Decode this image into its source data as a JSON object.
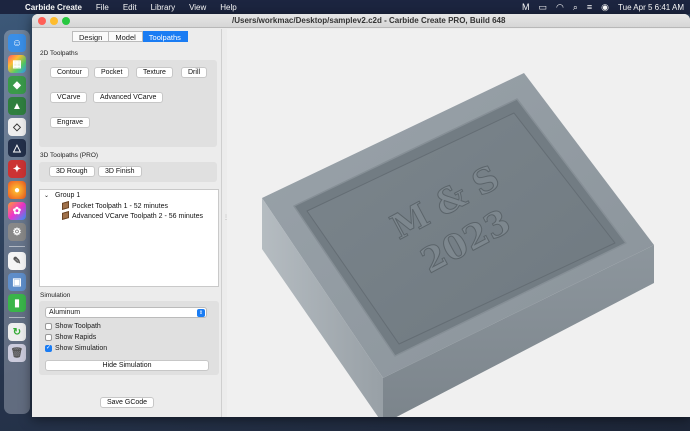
{
  "menubar": {
    "app_name": "Carbide Create",
    "items": [
      "File",
      "Edit",
      "Library",
      "View",
      "Help"
    ],
    "datetime": "Tue Apr 5  6:41 AM"
  },
  "window": {
    "title": "/Users/workmac/Desktop/samplev2.c2d - Carbide Create PRO, Build 648"
  },
  "tabs": [
    {
      "label": "Design",
      "active": false
    },
    {
      "label": "Model",
      "active": false
    },
    {
      "label": "Toolpaths",
      "active": true
    }
  ],
  "toolpaths_2d": {
    "heading": "2D Toolpaths",
    "buttons": [
      "Contour",
      "Pocket",
      "Texture",
      "Drill",
      "VCarve",
      "Advanced VCarve",
      "Engrave"
    ]
  },
  "toolpaths_3d": {
    "heading": "3D Toolpaths (PRO)",
    "buttons": [
      "3D Rough",
      "3D Finish"
    ]
  },
  "tree": {
    "group_label": "Group 1",
    "items": [
      "Pocket Toolpath 1 - 52 minutes",
      "Advanced VCarve Toolpath 2 - 56 minutes"
    ]
  },
  "simulation": {
    "heading": "Simulation",
    "material": "Aluminum",
    "options": [
      {
        "label": "Show Toolpath",
        "checked": false
      },
      {
        "label": "Show Rapids",
        "checked": false
      },
      {
        "label": "Show Simulation",
        "checked": true
      }
    ],
    "hide_button": "Hide Simulation"
  },
  "save_button": "Save GCode",
  "model_engraving": {
    "line1": "M & S",
    "line2": "2023"
  },
  "colors": {
    "accent": "#1a7cf3",
    "material_gray": "#8e989f"
  }
}
